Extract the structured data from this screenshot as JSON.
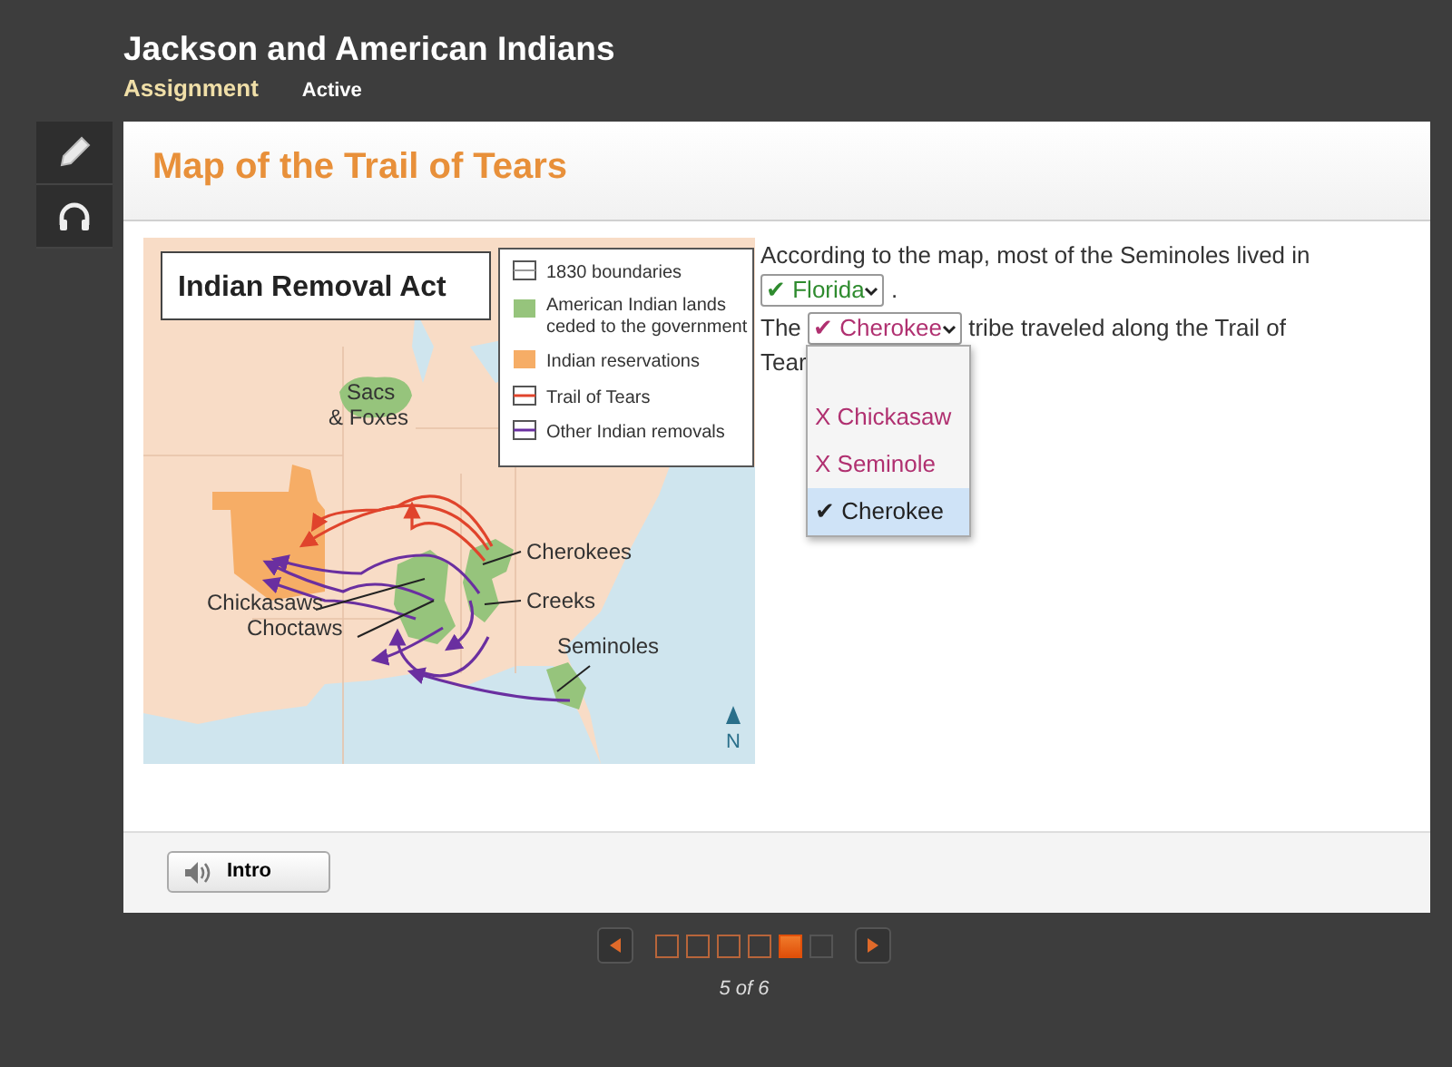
{
  "header": {
    "title": "Jackson and American Indians",
    "subtitle": "Assignment",
    "status": "Active"
  },
  "tools": [
    {
      "kind": "pencil"
    },
    {
      "kind": "headphones"
    }
  ],
  "activity": {
    "title": "Map of the Trail of Tears"
  },
  "map": {
    "title": "Indian Removal Act",
    "legend": [
      {
        "kind": "boundary",
        "label": "1830 boundaries"
      },
      {
        "kind": "ceded",
        "label": "American Indian lands ceded to the government"
      },
      {
        "kind": "reservation",
        "label": "Indian reservations"
      },
      {
        "kind": "trail",
        "label": "Trail of Tears"
      },
      {
        "kind": "removal",
        "label": "Other Indian removals"
      }
    ],
    "labels": [
      {
        "kind": "sacs",
        "text": "Sacs"
      },
      {
        "kind": "foxes",
        "text": "& Foxes"
      },
      {
        "kind": "cherokees",
        "text": "Cherokees"
      },
      {
        "kind": "creeks",
        "text": "Creeks"
      },
      {
        "kind": "chickasaws",
        "text": "Chickasaws"
      },
      {
        "kind": "choctaws",
        "text": "Choctaws"
      },
      {
        "kind": "seminoles",
        "text": "Seminoles"
      },
      {
        "kind": "north",
        "text": "N"
      }
    ]
  },
  "questions": [
    {
      "before": "According to the map, most of the Seminoles lived in",
      "select": {
        "value": "✔ Florida",
        "color": "#2e8b2e"
      },
      "after": "."
    },
    {
      "before": "The",
      "select": {
        "value": "✔ Cherokee",
        "color": "#b03070",
        "blank_option": true,
        "options": [
          {
            "label": "X Chickasaw",
            "color": "#b03070",
            "selected": false
          },
          {
            "label": "X Seminole",
            "color": "#b03070",
            "selected": false
          },
          {
            "label": "✔ Cherokee",
            "color": "#222222",
            "selected": true
          }
        ]
      },
      "after": "tribe traveled along the Trail of Tear"
    }
  ],
  "footer": {
    "button": "Intro"
  },
  "pager": {
    "pages": [
      {
        "visited": true,
        "selected": false
      },
      {
        "visited": true,
        "selected": false
      },
      {
        "visited": true,
        "selected": false
      },
      {
        "visited": true,
        "selected": false
      },
      {
        "visited": true,
        "selected": true
      },
      {
        "visited": false,
        "selected": false
      }
    ],
    "text": "5 of 6"
  }
}
